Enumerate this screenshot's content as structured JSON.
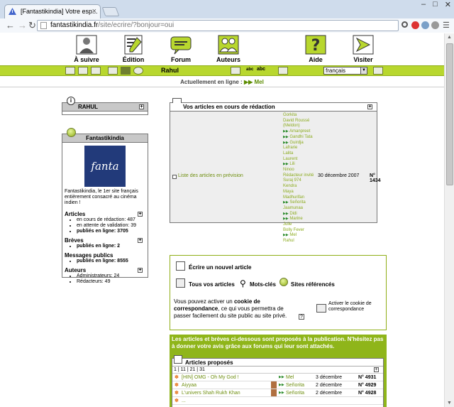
{
  "browser": {
    "tab_title": "[Fantastikindia] Votre esp...",
    "tab_close": "×",
    "url_host": "fantastikindia.fr",
    "url_path": "/site/ecrire/?bonjour=oui",
    "win_min": "–",
    "win_max": "□",
    "win_close": "✕"
  },
  "nav": {
    "items": [
      {
        "label": "À suivre"
      },
      {
        "label": "Édition"
      },
      {
        "label": "Forum"
      },
      {
        "label": "Auteurs"
      },
      {
        "label": "Aide"
      },
      {
        "label": "Visiter"
      }
    ]
  },
  "toolbar": {
    "user": "Rahul",
    "lang": "français",
    "abc1": "abc",
    "abc2": "abc"
  },
  "online": {
    "label": "Actuellement en ligne :",
    "user": "Mel"
  },
  "userbox": {
    "title": "RAHUL"
  },
  "sitebox": {
    "title": "Fantastikindia",
    "logo_text": "fanta",
    "description": "Fantastikindia, le 1er site français entièrement consacré au cinéma indien !",
    "articles_h": "Articles",
    "articles": [
      {
        "text": "en cours de rédaction: 487"
      },
      {
        "text": "en attente de validation: 39"
      },
      {
        "text": "publiés en ligne: 3705"
      }
    ],
    "breves_h": "Brèves",
    "breves": [
      {
        "text": "publiés en ligne: 2"
      }
    ],
    "messages_h": "Messages publics",
    "messages": [
      {
        "text": "publiés en ligne: 8555"
      }
    ],
    "auteurs_h": "Auteurs",
    "auteurs": [
      {
        "text": "Administrateurs: 24"
      },
      {
        "text": "Rédacteurs: 49"
      }
    ]
  },
  "articles_box": {
    "title": "Vos articles en cours de rédaction",
    "link": "Liste des articles en prévision",
    "date": "30 décembre 2007",
    "number": "N° 1434",
    "authors": [
      "Gorkita",
      "David Roussé",
      "(Meldon)",
      "Amanpreet",
      "Gandhi Tata",
      "Guirdja",
      "Lafrarie",
      "Lalita",
      "Laurent",
      "Lili",
      "Ninoo",
      "Rédacteur invité",
      "Suraj 974",
      "Kendra",
      "Maya",
      "Madhurifan",
      "Señorita",
      "Jaamunaa",
      "Didi",
      "Marine",
      "Julie",
      "Bolly Fever",
      "Mel",
      "Rahul"
    ]
  },
  "actions": {
    "write": "Écrire un nouvel article",
    "all": "Tous vos articles",
    "keywords": "Mots-clés",
    "sites": "Sites référencés",
    "cookie_pre": "Vous pouvez activer un",
    "cookie_bold": "cookie de correspondance",
    "cookie_post": ", ce qui vous permettra de passer facilement du site public au site privé.",
    "activate": "Activer le cookie de correspondance",
    "help": "?"
  },
  "proposed": {
    "notice": "Les articles et brèves ci-dessous sont proposés à la publication. N'hésitez pas à donner votre avis grâce aux forums qui leur sont attachés.",
    "title": "Articles proposés",
    "pages": "1 | 11 | 21 | 31",
    "rows": [
      {
        "title": "[HIN] OMG - Oh My God !",
        "author": "Mel",
        "date": "3 décembre",
        "num": "N° 4931"
      },
      {
        "title": "Aiyyaa",
        "author": "Señorita",
        "date": "2 décembre",
        "num": "N° 4929"
      },
      {
        "title": "L'univers Shah Rukh Khan",
        "author": "Señorita",
        "date": "2 décembre",
        "num": "N° 4928"
      },
      {
        "title": "...",
        "author": "",
        "date": "",
        "num": ""
      }
    ]
  }
}
